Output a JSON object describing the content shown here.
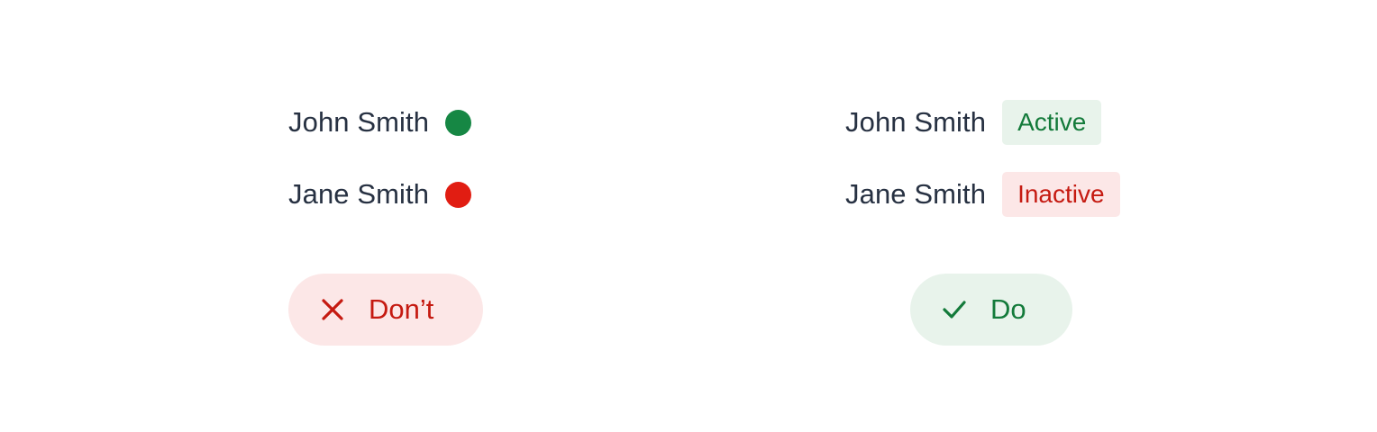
{
  "colors": {
    "text": "#273142",
    "active": "#168744",
    "inactive": "#E11D12",
    "active_badge_bg": "#E8F3EB",
    "active_badge_text": "#137A3A",
    "inactive_badge_bg": "#FCE7E7",
    "inactive_badge_text": "#C51A11",
    "dont_bg": "#FCE7E7",
    "dont_text": "#C51A11",
    "do_bg": "#E8F3EB",
    "do_text": "#137A3A"
  },
  "dont_example": {
    "rows": [
      {
        "name": "John Smith",
        "status_color": "#168744"
      },
      {
        "name": "Jane Smith",
        "status_color": "#E11D12"
      }
    ],
    "label": "Don’t",
    "icon": "close-icon"
  },
  "do_example": {
    "rows": [
      {
        "name": "John Smith",
        "status": "Active"
      },
      {
        "name": "Jane Smith",
        "status": "Inactive"
      }
    ],
    "label": "Do",
    "icon": "check-icon"
  }
}
